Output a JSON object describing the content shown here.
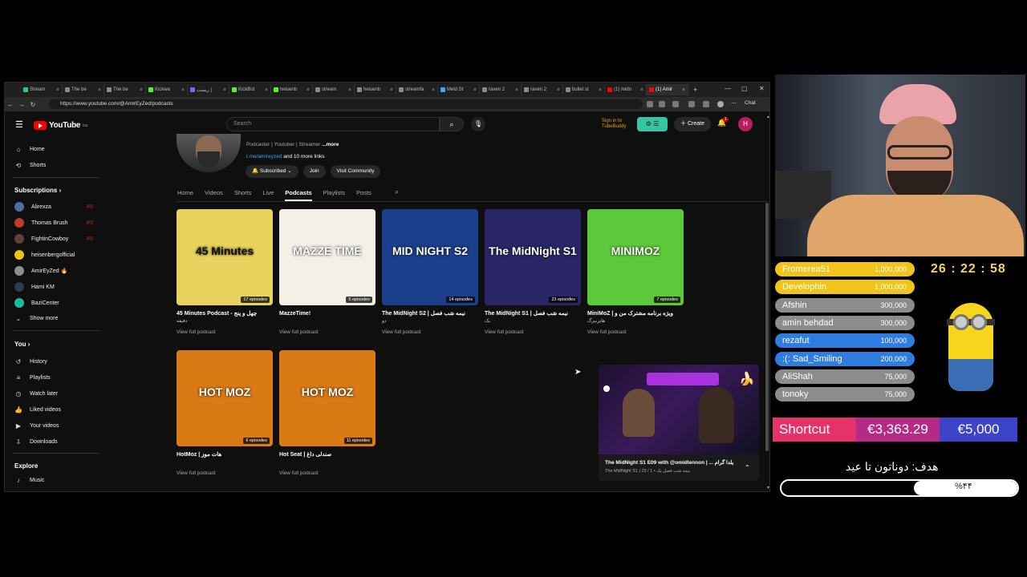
{
  "browser": {
    "tabs": [
      {
        "label": "Stream",
        "color": "#2ecc71"
      },
      {
        "label": "The be",
        "color": "#888888"
      },
      {
        "label": "The be",
        "color": "#888888"
      },
      {
        "label": "Kickwa",
        "color": "#53fc18"
      },
      {
        "label": "ریست |",
        "color": "#7b68ee"
      },
      {
        "label": "KickBot",
        "color": "#53fc18"
      },
      {
        "label": "heisenb",
        "color": "#53fc18"
      },
      {
        "label": "stream",
        "color": "#888888"
      },
      {
        "label": "heisenb",
        "color": "#888888"
      },
      {
        "label": "streamfa",
        "color": "#888888"
      },
      {
        "label": "Meld St",
        "color": "#3ea6ff"
      },
      {
        "label": "raven 2",
        "color": "#888888"
      },
      {
        "label": "raven 2",
        "color": "#888888"
      },
      {
        "label": "bullet st",
        "color": "#888888"
      },
      {
        "label": "(1) midn",
        "color": "#ff0000"
      },
      {
        "label": "(1) Amir",
        "color": "#ff0000"
      }
    ],
    "url": "https://www.youtube.com/@AmirEyZed/podcasts",
    "chat_label": "Chat"
  },
  "youtube": {
    "logo_text": "YouTube",
    "logo_country": "DE",
    "search_placeholder": "Search",
    "tubebuddy_line1": "Sign in to",
    "tubebuddy_line2": "TubeBuddy",
    "create_label": "Create",
    "bell_badge": "1",
    "user_initial": "H"
  },
  "sidebar": {
    "home": "Home",
    "shorts": "Shorts",
    "subscriptions_header": "Subscriptions",
    "subscriptions": [
      {
        "name": "Alirexza",
        "color": "#4a6fa5",
        "live": true
      },
      {
        "name": "Thomas Brush",
        "color": "#c0392b",
        "live": true
      },
      {
        "name": "FightinCowboy",
        "color": "#5d4037",
        "live": true
      },
      {
        "name": "heisenbergofficial",
        "color": "#f1c40f",
        "live": false
      },
      {
        "name": "AmirEyZed 🔥",
        "color": "#8e8e8e",
        "live": false
      },
      {
        "name": "Hami KM",
        "color": "#2c3e50",
        "live": false
      },
      {
        "name": "BaziCenter",
        "color": "#1abc9c",
        "live": false
      }
    ],
    "show_more": "Show more",
    "you_header": "You",
    "you_items": [
      "History",
      "Playlists",
      "Watch later",
      "Liked videos",
      "Your videos",
      "Downloads"
    ],
    "explore_header": "Explore",
    "explore_items": [
      "Music"
    ]
  },
  "channel": {
    "meta": "Podcaster | Youtuber | Streamer",
    "more": "...more",
    "link": "t.me/amireyzed",
    "link_more": "and 10 more links",
    "subscribed_label": "Subscribed",
    "join_label": "Join",
    "community_label": "Visit Community",
    "tabs": [
      "Home",
      "Videos",
      "Shorts",
      "Live",
      "Podcasts",
      "Playlists",
      "Posts"
    ],
    "active_tab": "Podcasts"
  },
  "podcasts": [
    {
      "title": "45 Minutes Podcast - چهل و پنج",
      "title2": "دقیقه",
      "episodes": "17 episodes",
      "thumb_text": "45 Minutes",
      "bg": "#e8d35e"
    },
    {
      "title": "MazzeTime!",
      "title2": "",
      "episodes": "5 episodes",
      "thumb_text": "MAZZE TIME",
      "bg": "#f4f0e6"
    },
    {
      "title": "The MidNight S2 | نیمه شب فصل",
      "title2": "دو",
      "episodes": "14 episodes",
      "thumb_text": "MID NIGHT S2",
      "bg": "#1b3f8a"
    },
    {
      "title": "The MidNight S1 | نیمه شب فصل",
      "title2": "یک",
      "episodes": "23 episodes",
      "thumb_text": "The MidNight S1",
      "bg": "#2a2665"
    },
    {
      "title": "MiniMoZ | ویژه برنامه مشترک من و",
      "title2": "هایزنبرگ",
      "episodes": "7 episodes",
      "thumb_text": "MINIMOZ",
      "bg": "#5cc93a"
    },
    {
      "title": "HotMoz | هات موز",
      "title2": "",
      "episodes": "6 episodes",
      "thumb_text": "HOT MOZ",
      "bg": "#d97a14"
    },
    {
      "title": "Hot Seat | صندلی داغ",
      "title2": "",
      "episodes": "11 episodes",
      "thumb_text": "HOT MOZ",
      "bg": "#d97a14"
    }
  ],
  "view_full": "View full podcast",
  "miniplayer": {
    "title": "The MidNight S1 E09 with @omidlennon | ... یلدا گرام",
    "sub": "The MidNight S1 | نیمه شب فصل یک • 1 / 23"
  },
  "overlay": {
    "donors": [
      {
        "name": "Fromerea51",
        "amount": "1,000,000",
        "color": "#f0c419"
      },
      {
        "name": "Develophin",
        "amount": "1,000,000",
        "color": "#f0c419"
      },
      {
        "name": "Afshin",
        "amount": "300,000",
        "color": "#8c8c8c"
      },
      {
        "name": "amin behdad",
        "amount": "300,000",
        "color": "#8c8c8c"
      },
      {
        "name": "rezafut",
        "amount": "100,000",
        "color": "#2f7de1"
      },
      {
        "name": ":(: Sad_Smiling",
        "amount": "200,000",
        "color": "#2f7de1"
      },
      {
        "name": "AliShah",
        "amount": "75,000",
        "color": "#8c8c8c"
      },
      {
        "name": "tonoky",
        "amount": "75,000",
        "color": "#8c8c8c"
      }
    ],
    "timer": "26 : 22 : 58",
    "shortcut_label": "Shortcut",
    "shortcut_amount": "€3,363.29",
    "shortcut_goal": "€5,000",
    "goal_text": "هدف: دوناتون تا عید",
    "goal_percent_text": "%۴۴",
    "goal_percent": 0.44
  }
}
